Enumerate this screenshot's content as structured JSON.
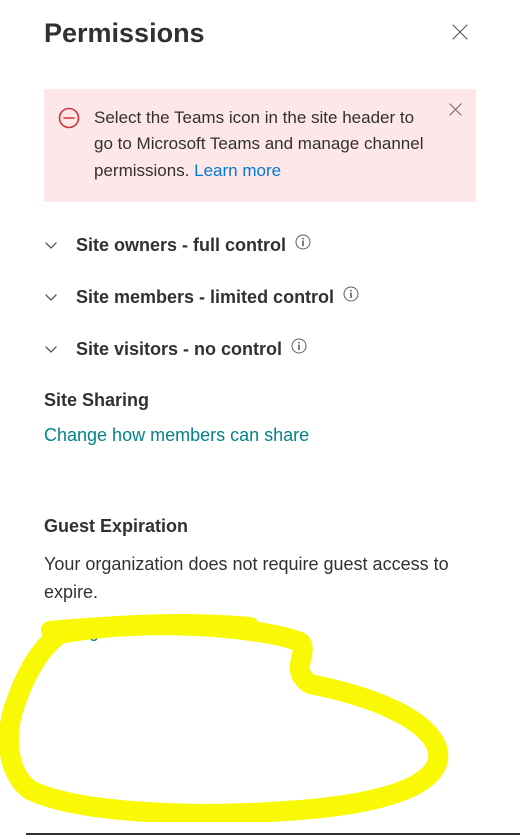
{
  "header": {
    "title": "Permissions"
  },
  "alert": {
    "text_part1": "Select the Teams icon in the site header to go to Microsoft Teams and manage channel permissions.  ",
    "learn_more": "Learn more"
  },
  "groups": [
    {
      "label": "Site owners - full control"
    },
    {
      "label": "Site members - limited control"
    },
    {
      "label": "Site visitors - no control"
    }
  ],
  "site_sharing": {
    "heading": "Site Sharing",
    "link": "Change how members can share"
  },
  "guest_expiration": {
    "heading": "Guest Expiration",
    "body": "Your organization does not require guest access to expire.",
    "link": "Manage"
  }
}
